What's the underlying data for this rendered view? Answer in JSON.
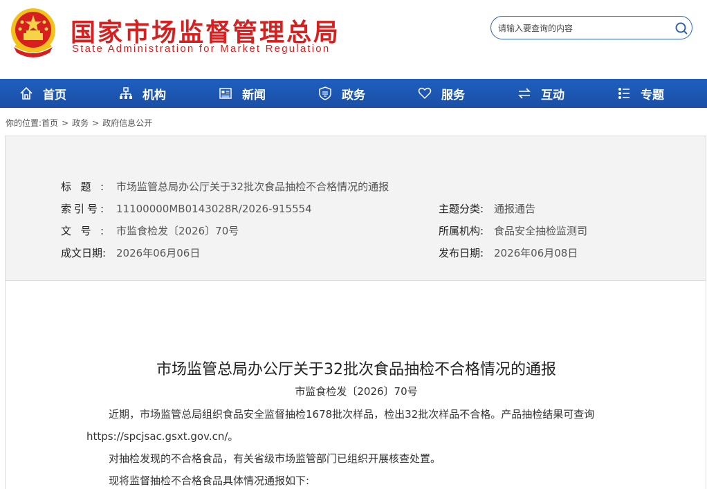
{
  "header": {
    "title_cn": "国家市场监督管理总局",
    "title_en": "State Administration for Market Regulation",
    "emblem": "national-emblem",
    "search_placeholder": "请输入要查询的内容",
    "search_icon": "search-icon"
  },
  "colors": {
    "brand_red": "#d6201f",
    "nav_blue": "#1f5fbf",
    "panel_bg": "#f3f3f3"
  },
  "nav": {
    "items": [
      {
        "label": "首页",
        "icon": "home-icon"
      },
      {
        "label": "机构",
        "icon": "org-chart-icon"
      },
      {
        "label": "新闻",
        "icon": "news-icon"
      },
      {
        "label": "政务",
        "icon": "shield-icon"
      },
      {
        "label": "服务",
        "icon": "heart-icon"
      },
      {
        "label": "互动",
        "icon": "exchange-icon"
      },
      {
        "label": "专题",
        "icon": "list-icon"
      }
    ]
  },
  "breadcrumb": {
    "prefix": "你的位置:",
    "items": [
      "首页",
      "政务",
      "政府信息公开"
    ],
    "separator": ">"
  },
  "info": {
    "title_label": "标题:",
    "title_value": "市场监管总局办公厅关于32批次食品抽检不合格情况的通报",
    "index_label": "索引号:",
    "index_value": "11100000MB0143028R/2026-915554",
    "category_label": "主题分类:",
    "category_value": "通报通告",
    "docno_label": "文号:",
    "docno_value": "市监食检发〔2026〕70号",
    "org_label": "所属机构:",
    "org_value": "食品安全抽检监测司",
    "written_label": "成文日期:",
    "written_value": "2026年06月06日",
    "publish_label": "发布日期:",
    "publish_value": "2026年06月08日"
  },
  "document": {
    "title": "市场监管总局办公厅关于32批次食品抽检不合格情况的通报",
    "number": "市监食检发〔2026〕70号",
    "para1_line1": "近期，市场监管总局组织食品安全监督抽检1678批次样品，检出32批次样品不合格。产品抽检结果可查询",
    "para1_line2": "https://spcjsac.gsxt.gov.cn/。",
    "para2": "对抽检发现的不合格食品，有关省级市场监管部门已组织开展核查处置。",
    "para3": "现将监督抽检不合格食品具体情况通报如下:"
  }
}
